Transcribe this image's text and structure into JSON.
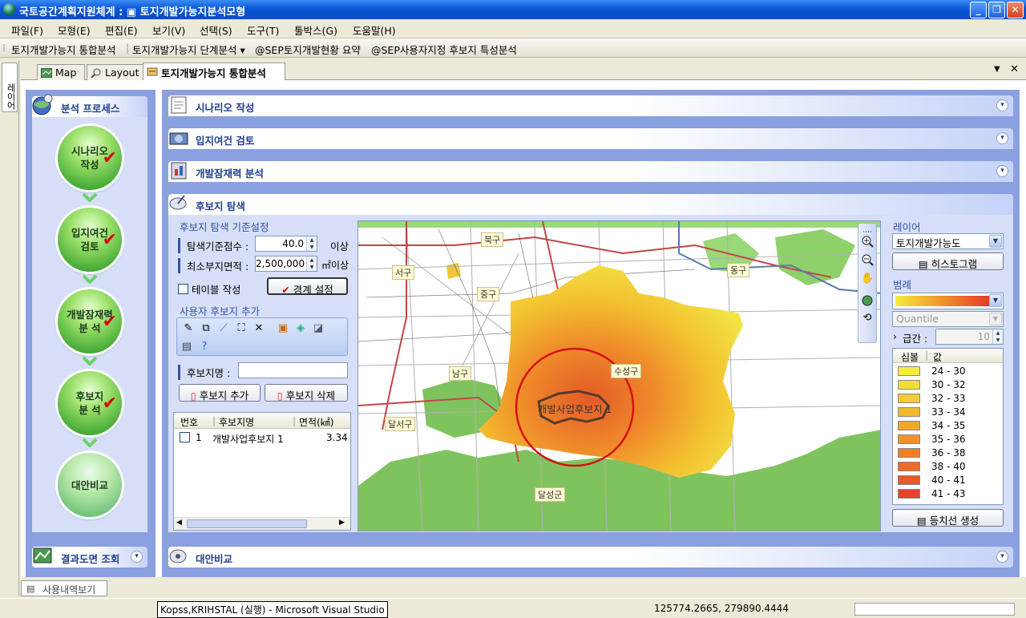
{
  "window": {
    "title": "국토공간계획지원체계 : ▣ 토지개발가능지분석모형",
    "controls": [
      "_",
      "❐",
      "✕"
    ]
  },
  "menu": [
    "파일(F)",
    "모형(E)",
    "편집(E)",
    "보기(V)",
    "선택(S)",
    "도구(T)",
    "툴박스(G)",
    "도움말(H)"
  ],
  "toolbar": [
    "토지개발가능지 통합분석",
    "토지개발가능지 단계분석 ▾",
    "@SEP토지개발현황 요약",
    "@SEP사용자지정 후보지 특성분석"
  ],
  "dock": {
    "layer_tab": "레이어"
  },
  "doc_tabs": [
    {
      "label": "Map",
      "icon": "map-icon"
    },
    {
      "label": "Layout",
      "icon": "magnifier-icon"
    },
    {
      "label": "토지개발가능지 통합분석",
      "icon": "analysis-icon"
    }
  ],
  "process": {
    "header": "분석 프로세스",
    "steps": [
      {
        "label": "시나리오\n작성",
        "done": true
      },
      {
        "label": "입지여건\n검토",
        "done": true
      },
      {
        "label": "개발잠재력\n분 석",
        "done": true
      },
      {
        "label": "후보지\n분 석",
        "done": true
      },
      {
        "label": "대안비교",
        "done": false
      }
    ],
    "result_header": "결과도면 조회"
  },
  "sections": {
    "scenario": "시나리오 작성",
    "location": "입지여건 검토",
    "potential": "개발잠재력 분석",
    "search": "후보지 탐색",
    "compare": "대안비교"
  },
  "criteria": {
    "title": "후보지 탐색 기준설정",
    "score_label": "탐색기준점수 :",
    "score_value": "40.0",
    "score_unit": "이상",
    "area_label": "최소부지면적 :",
    "area_value": "2,500,000",
    "area_unit": "㎡이상",
    "table_check_label": "테이블 작성",
    "boundary_button": "경계 설정"
  },
  "user_add": {
    "title": "사용자 후보지 추가",
    "name_label": "후보지명 :",
    "name_value": "",
    "add_button": "후보지 추가",
    "delete_button": "후보지 삭제"
  },
  "candidate_table": {
    "columns": [
      "번호",
      "후보지명",
      "면적(㎢)"
    ],
    "rows": [
      {
        "no": "1",
        "name": "개발사업후보지 1",
        "area": "3.34",
        "checked": false
      }
    ]
  },
  "map": {
    "labels": {
      "bukgu": "북구",
      "seogu": "서구",
      "junggu": "중구",
      "donggu": "동구",
      "namgu": "남구",
      "suseonggu": "수성구",
      "dalseogu": "달서구",
      "dalseonggun": "달성군",
      "candidate": "개발사업후보지 1"
    }
  },
  "layer_panel": {
    "layer_label": "레이어",
    "layer_value": "토지개발가능도",
    "histogram_button": "히스토그램",
    "legend_label": "범례",
    "classify_value": "Quantile",
    "interval_label": "급간 :",
    "interval_value": "10",
    "legend_columns": [
      "심볼",
      "값"
    ],
    "legend": [
      {
        "range": "24 - 30",
        "color": "#f5ec3c"
      },
      {
        "range": "30 - 32",
        "color": "#f4dc36"
      },
      {
        "range": "32 - 33",
        "color": "#f3cc31"
      },
      {
        "range": "33 - 34",
        "color": "#f2b82e"
      },
      {
        "range": "34 - 35",
        "color": "#f1a52c"
      },
      {
        "range": "35 - 36",
        "color": "#f0922b"
      },
      {
        "range": "36 - 38",
        "color": "#ee7f2a"
      },
      {
        "range": "38 - 40",
        "color": "#ec6b29"
      },
      {
        "range": "40 - 41",
        "color": "#e95828"
      },
      {
        "range": "41 - 43",
        "color": "#e64328"
      }
    ],
    "contour_button": "등치선 생성"
  },
  "bottom_tab": "사용내역보기",
  "status": {
    "task": "Kopss,KRIHSTAL (실행) - Microsoft Visual Studio",
    "coords": "125774.2665, 279890.4444"
  }
}
